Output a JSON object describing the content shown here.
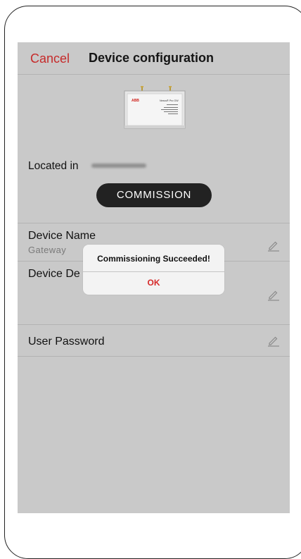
{
  "nav": {
    "cancel_label": "Cancel",
    "title": "Device configuration"
  },
  "device": {
    "image_icon": "gateway-device-image",
    "brand_text": "ABB",
    "model_text": "Nexus® Pro GW"
  },
  "location": {
    "label": "Located in"
  },
  "commission_button": {
    "label": "COMMISSION"
  },
  "fields": [
    {
      "label": "Device Name",
      "value": "Gateway",
      "icon": "pencil-icon"
    },
    {
      "label": "Device De",
      "value": "",
      "icon": "pencil-icon"
    },
    {
      "label": "User Password",
      "value": "",
      "icon": "pencil-icon"
    }
  ],
  "alert": {
    "title": "Commissioning Succeeded!",
    "ok_label": "OK"
  },
  "colors": {
    "accent_red": "#c62b2b",
    "screen_dimmed_bg": "#c9c9c9",
    "button_dark": "#222222",
    "alert_bg": "#f3f3f3"
  }
}
